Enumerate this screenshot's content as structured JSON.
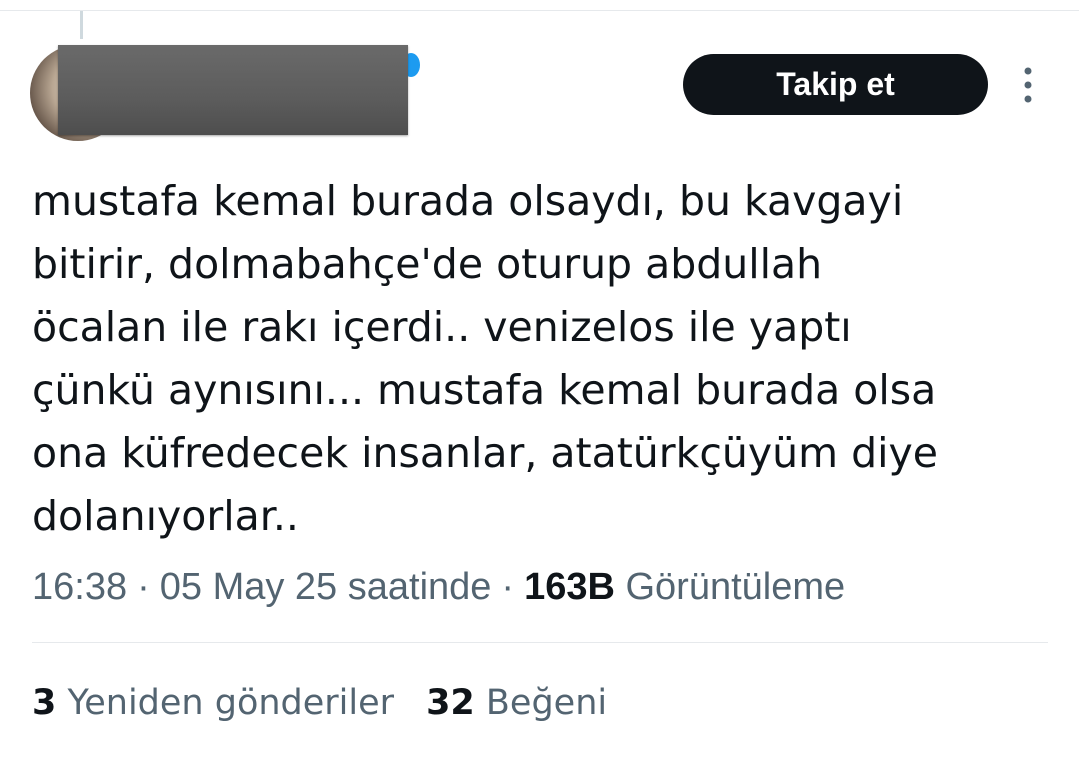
{
  "tweet": {
    "follow_label": "Takip et",
    "text_lines": [
      "mustafa kemal burada olsaydı, bu kavgayi",
      "bitirir, dolmabahçe'de oturup abdullah",
      "öcalan ile rakı içerdi.. venizelos ile yaptı",
      "çünkü aynısını... mustafa kemal burada olsa",
      "ona küfredecek insanlar, atatürkçüyüm diye",
      "dolanıyorlar.."
    ],
    "time": "16:38",
    "separator": "·",
    "date": "05 May 25 saatinde",
    "views_count": "163B",
    "views_label": "Görüntüleme"
  },
  "stats": {
    "reposts_count": "3",
    "reposts_label": "Yeniden gönderiler",
    "likes_count": "32",
    "likes_label": "Beğeni"
  },
  "colors": {
    "text": "#0f1419",
    "secondary_text": "#536471",
    "button_bg": "#0f1419",
    "verified": "#1d9bf0",
    "divider": "#e6e9ec"
  },
  "icons": {
    "verified": "verified-badge-icon",
    "more": "more-vertical-icon"
  }
}
